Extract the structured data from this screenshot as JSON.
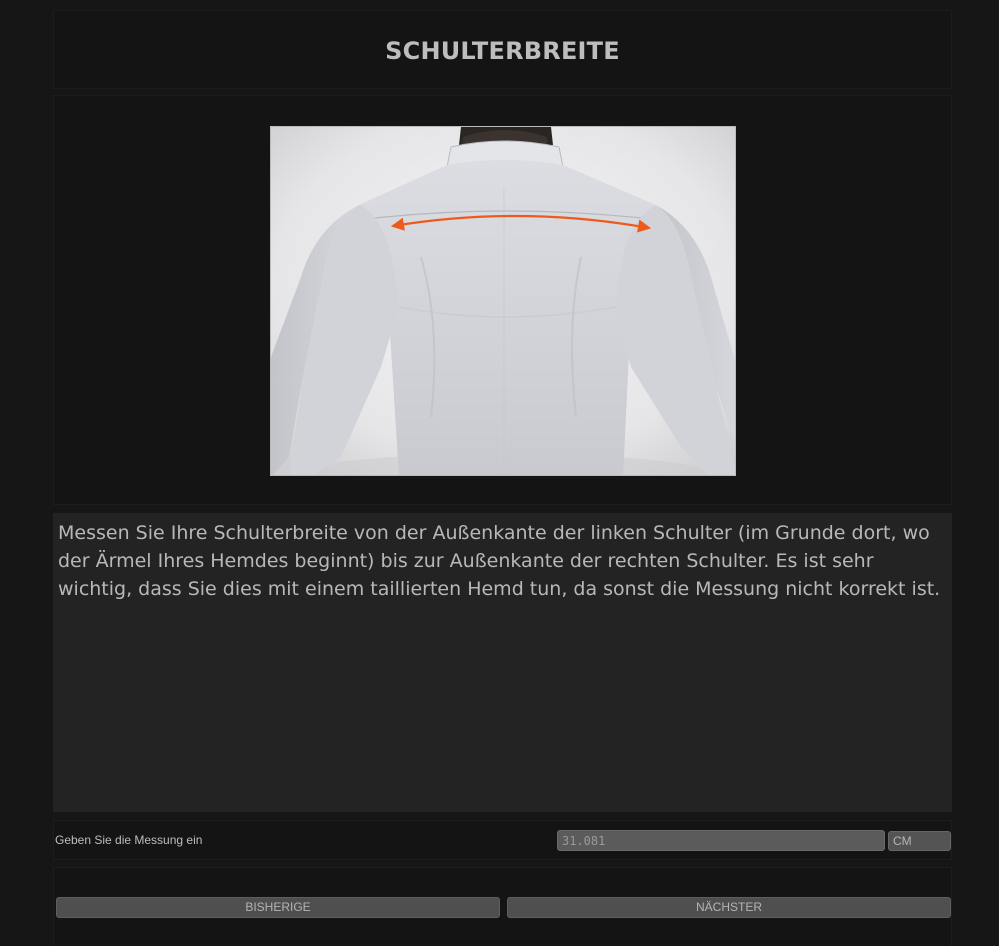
{
  "header": {
    "title": "SCHULTERBREITE"
  },
  "image": {
    "icon": "shoulder-measurement-photo",
    "arrow_color": "#ee5a1c"
  },
  "description": {
    "text": "Messen Sie Ihre Schulterbreite von der Außenkante der linken Schulter (im Grunde dort, wo der Ärmel Ihres Hemdes beginnt) bis zur Außenkante der rechten Schulter. Es ist sehr wichtig, dass Sie dies mit einem taillierten Hemd tun, da sonst die Messung nicht korrekt ist."
  },
  "measurement": {
    "label": "Geben Sie die Messung ein",
    "value": "31.081",
    "unit": "CM"
  },
  "navigation": {
    "previous_label": "BISHERIGE",
    "next_label": "NÄCHSTER"
  }
}
